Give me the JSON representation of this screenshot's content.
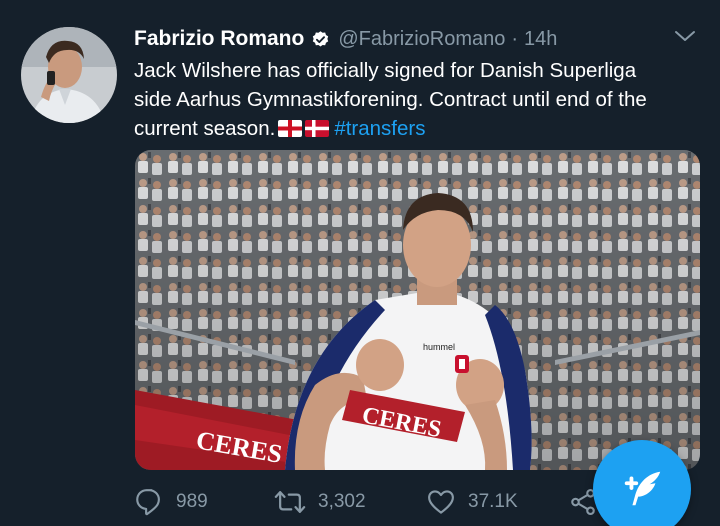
{
  "tweet": {
    "author_name": "Fabrizio Romano",
    "handle": "@FabrizioRomano",
    "separator": "·",
    "time": "14h",
    "text_line1": "Jack Wilshere has officially signed for Danish Superliga",
    "text_line2": "side Aarhus Gymnastikforening. Contract until end of the",
    "text_line3": "current season.",
    "flags": [
      "england-flag",
      "denmark-flag"
    ],
    "hashtag": "#transfers"
  },
  "media": {
    "shirt_sponsor": "CERES",
    "banner_text": "CERES",
    "shirt_brand": "hummel"
  },
  "actions": {
    "reply_count": "989",
    "retweet_count": "3,302",
    "like_count": "37.1K"
  },
  "icons": {
    "reply": "reply-icon",
    "retweet": "retweet-icon",
    "like": "heart-icon",
    "share": "share-icon",
    "compose": "compose-tweet-icon",
    "verified": "verified-badge-icon",
    "more": "chevron-down-icon"
  },
  "colors": {
    "background": "#15202b",
    "accent": "#1da1f2",
    "secondary_text": "#8899a6"
  }
}
